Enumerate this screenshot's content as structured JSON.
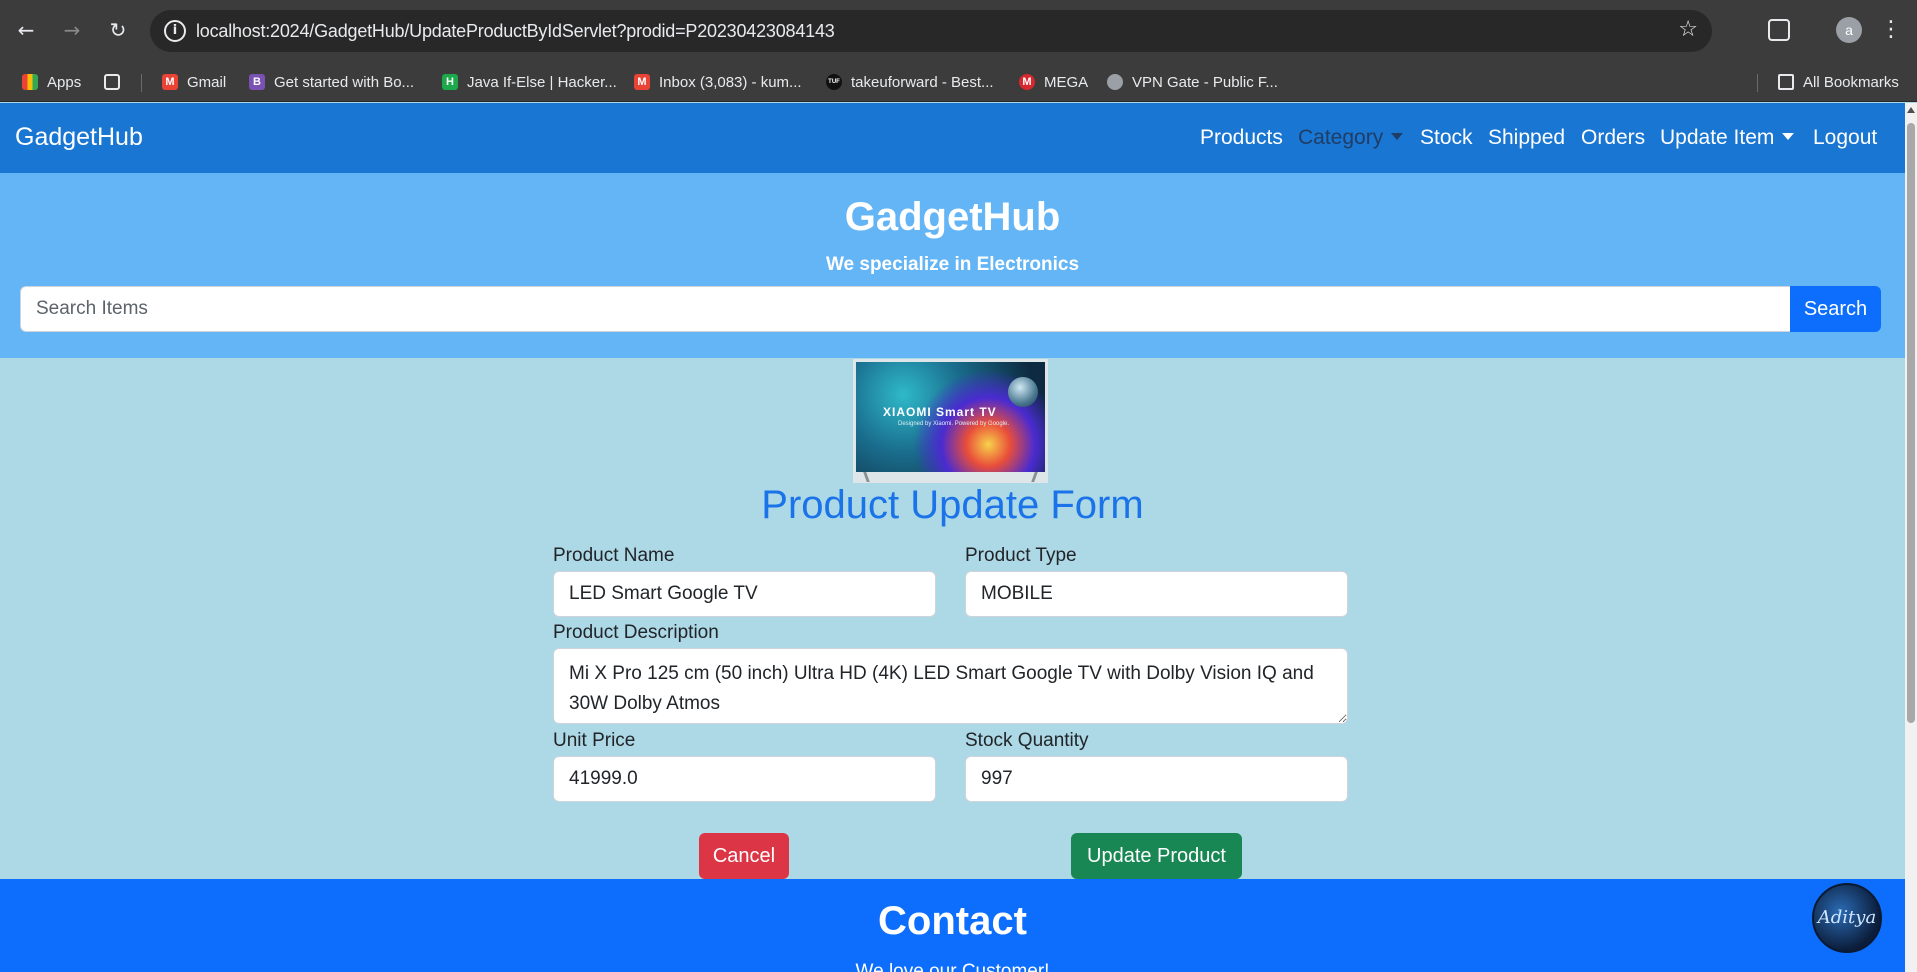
{
  "browser": {
    "url": "localhost:2024/GadgetHub/UpdateProductByIdServlet?prodid=P20230423084143",
    "profile_initial": "a",
    "bookmarks": [
      {
        "label": "Apps",
        "icon": "apps-grid-icon",
        "color": "#4285f4"
      },
      {
        "label": "",
        "icon": "tab-groups-icon",
        "color": "#e8eaed"
      },
      {
        "label": "Gmail",
        "icon": "gmail-icon",
        "color": "#ea4335"
      },
      {
        "label": "Get started with Bo...",
        "icon": "bootstrap-icon",
        "color": "#7952b3",
        "glyph": "B"
      },
      {
        "label": "Java If-Else | Hacker...",
        "icon": "hackerrank-icon",
        "color": "#1ba94c",
        "glyph": "H"
      },
      {
        "label": "Inbox (3,083) - kum...",
        "icon": "gmail-icon",
        "color": "#ea4335"
      },
      {
        "label": "takeuforward - Best...",
        "icon": "takeuforward-icon",
        "color": "#111111",
        "glyph": "TUF"
      },
      {
        "label": "MEGA",
        "icon": "mega-icon",
        "color": "#d9272e",
        "glyph": "M"
      },
      {
        "label": "VPN Gate - Public F...",
        "icon": "globe-icon",
        "color": "#9aa0a6"
      }
    ],
    "all_bookmarks": "All Bookmarks"
  },
  "navbar": {
    "brand": "GadgetHub",
    "links": {
      "products": "Products",
      "category": "Category",
      "stock": "Stock",
      "shipped": "Shipped",
      "orders": "Orders",
      "update_item": "Update Item",
      "logout": "Logout"
    }
  },
  "hero": {
    "title": "GadgetHub",
    "subtitle": "We specialize in Electronics",
    "search_placeholder": "Search Items",
    "search_button": "Search"
  },
  "product_image": {
    "brand_text": "XIAOMI Smart TV",
    "tagline": "Designed by Xiaomi. Powered by Google."
  },
  "form": {
    "title": "Product Update Form",
    "product_name": {
      "label": "Product Name",
      "value": "LED Smart Google TV"
    },
    "product_type": {
      "label": "Product Type",
      "value": "MOBILE"
    },
    "product_description": {
      "label": "Product Description",
      "value": "Mi X Pro 125 cm (50 inch) Ultra HD (4K) LED Smart Google TV with Dolby Vision IQ and 30W Dolby Atmos"
    },
    "unit_price": {
      "label": "Unit Price",
      "value": "41999.0"
    },
    "stock_quantity": {
      "label": "Stock Quantity",
      "value": "997"
    },
    "cancel_button": "Cancel",
    "update_button": "Update Product"
  },
  "footer": {
    "title": "Contact",
    "subtitle": "We love our Customer!"
  },
  "floating_avatar": {
    "text": "Aditya"
  },
  "colors": {
    "navbar": "#1976d2",
    "hero": "#64b5f6",
    "page_bg": "#ADD8E6",
    "primary": "#0d6efd",
    "danger": "#dc3545",
    "success": "#198754",
    "form_title": "#1a73e8"
  }
}
